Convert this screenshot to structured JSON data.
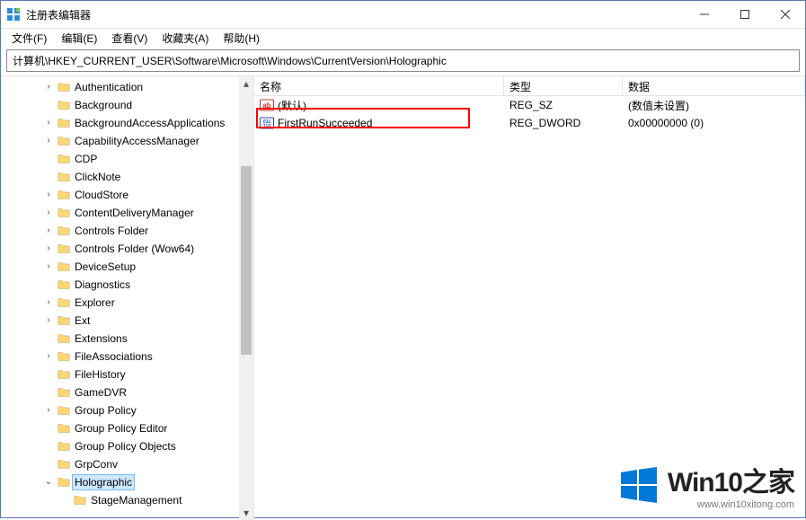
{
  "window": {
    "title": "注册表编辑器"
  },
  "menu": {
    "file": "文件(F)",
    "edit": "编辑(E)",
    "view": "查看(V)",
    "favorites": "收藏夹(A)",
    "help": "帮助(H)"
  },
  "address": "计算机\\HKEY_CURRENT_USER\\Software\\Microsoft\\Windows\\CurrentVersion\\Holographic",
  "tree": {
    "items": [
      {
        "indent": 44,
        "expander": ">",
        "label": "Authentication"
      },
      {
        "indent": 44,
        "expander": "",
        "label": "Background"
      },
      {
        "indent": 44,
        "expander": ">",
        "label": "BackgroundAccessApplications"
      },
      {
        "indent": 44,
        "expander": ">",
        "label": "CapabilityAccessManager"
      },
      {
        "indent": 44,
        "expander": "",
        "label": "CDP"
      },
      {
        "indent": 44,
        "expander": "",
        "label": "ClickNote"
      },
      {
        "indent": 44,
        "expander": ">",
        "label": "CloudStore"
      },
      {
        "indent": 44,
        "expander": ">",
        "label": "ContentDeliveryManager"
      },
      {
        "indent": 44,
        "expander": ">",
        "label": "Controls Folder"
      },
      {
        "indent": 44,
        "expander": ">",
        "label": "Controls Folder (Wow64)"
      },
      {
        "indent": 44,
        "expander": ">",
        "label": "DeviceSetup"
      },
      {
        "indent": 44,
        "expander": "",
        "label": "Diagnostics"
      },
      {
        "indent": 44,
        "expander": ">",
        "label": "Explorer"
      },
      {
        "indent": 44,
        "expander": ">",
        "label": "Ext"
      },
      {
        "indent": 44,
        "expander": "",
        "label": "Extensions"
      },
      {
        "indent": 44,
        "expander": ">",
        "label": "FileAssociations"
      },
      {
        "indent": 44,
        "expander": "",
        "label": "FileHistory"
      },
      {
        "indent": 44,
        "expander": "",
        "label": "GameDVR"
      },
      {
        "indent": 44,
        "expander": ">",
        "label": "Group Policy"
      },
      {
        "indent": 44,
        "expander": "",
        "label": "Group Policy Editor"
      },
      {
        "indent": 44,
        "expander": "",
        "label": "Group Policy Objects"
      },
      {
        "indent": 44,
        "expander": "",
        "label": "GrpConv"
      },
      {
        "indent": 44,
        "expander": "v",
        "label": "Holographic",
        "selected": true
      },
      {
        "indent": 62,
        "expander": "",
        "label": "StageManagement"
      }
    ]
  },
  "list": {
    "columns": {
      "name": "名称",
      "type": "类型",
      "data": "数据"
    },
    "rows": [
      {
        "icon": "string",
        "name": "(默认)",
        "type": "REG_SZ",
        "data": "(数值未设置)"
      },
      {
        "icon": "binary",
        "name": "FirstRunSucceeded",
        "type": "REG_DWORD",
        "data": "0x00000000 (0)"
      }
    ]
  },
  "watermark": {
    "line1": "Win10之家",
    "line2": "www.win10xitong.com"
  }
}
